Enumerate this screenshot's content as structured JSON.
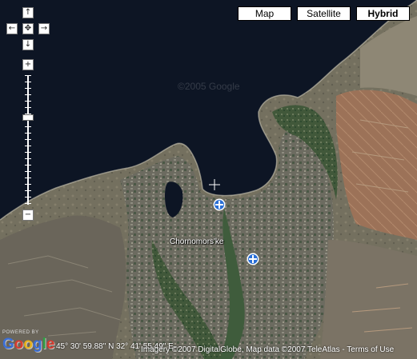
{
  "map_types": [
    {
      "label": "Map",
      "active": false
    },
    {
      "label": "Satellite",
      "active": false
    },
    {
      "label": "Hybrid",
      "active": true
    }
  ],
  "nav_controls": {
    "up": "↑",
    "left": "←",
    "center": "✥",
    "right": "→",
    "down": "↓",
    "zoom_in": "+",
    "zoom_out": "−"
  },
  "place_label": "Chornomors'ke",
  "watermark": "©2005 Google",
  "coordinates": "45° 30' 59.88\" N 32° 41' 55.49\" E",
  "powered_by": "POWERED BY",
  "logo_letters": [
    "G",
    "o",
    "o",
    "g",
    "l",
    "e"
  ],
  "attribution_prefix": "Imagery ©2007 DigitalGlobe, Map data ©2007 TeleAtlas - ",
  "terms_link": "Terms of Use",
  "colors": {
    "sea": "#0d1524",
    "land": "#5f5d50",
    "vegetation": "#3f5c3c",
    "fields": "#a8735c",
    "marker": "#2a6fd6",
    "logo": [
      "#3b6fd6",
      "#d63b2f",
      "#e8b21c",
      "#3b6fd6",
      "#2f9e44",
      "#d63b2f"
    ]
  },
  "icons": [
    "pan-up-icon",
    "pan-left-icon",
    "pan-center-icon",
    "pan-right-icon",
    "pan-down-icon",
    "zoom-in-icon",
    "zoom-out-icon",
    "map-marker-icon",
    "crosshair-icon"
  ]
}
